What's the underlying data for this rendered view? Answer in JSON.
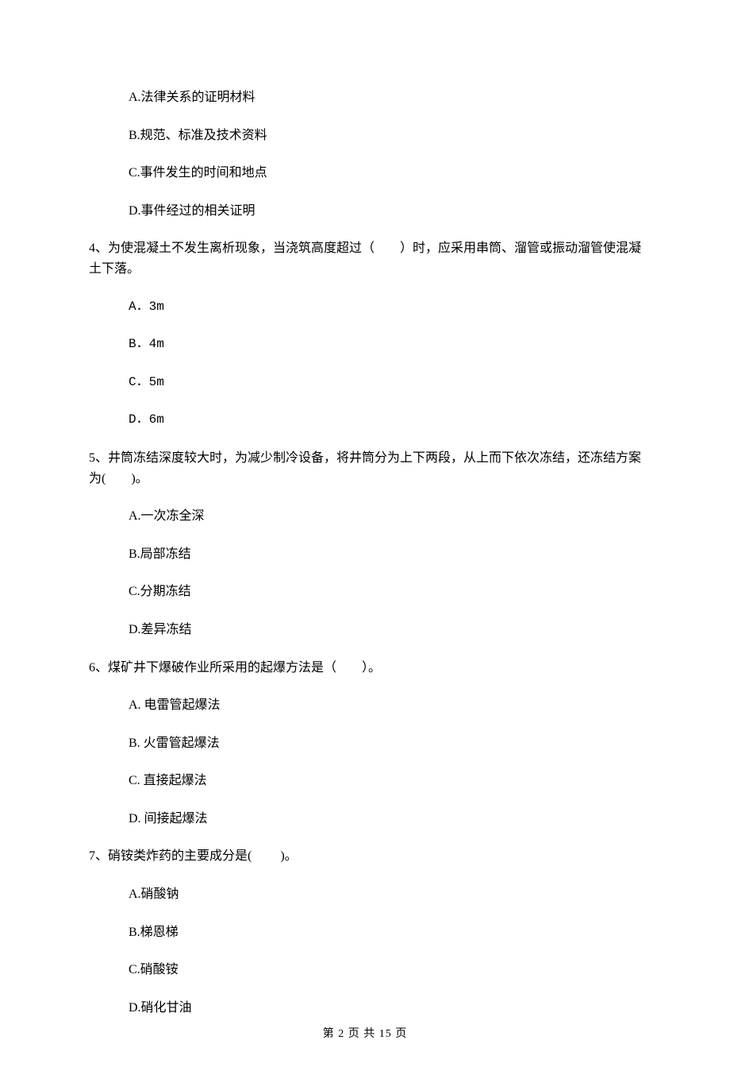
{
  "q3": {
    "options": {
      "A": "A.法律关系的证明材料",
      "B": "B.规范、标准及技术资料",
      "C": "C.事件发生的时间和地点",
      "D": "D.事件经过的相关证明"
    }
  },
  "q4": {
    "stem": "4、为使混凝土不发生离析现象，当浇筑高度超过（　　）时，应采用串筒、溜管或振动溜管使混凝土下落。",
    "options": {
      "A": "A．3m",
      "B": "B．4m",
      "C": "C．5m",
      "D": "D．6m"
    }
  },
  "q5": {
    "stem": "5、井筒冻结深度较大时，为减少制冷设备，将井筒分为上下两段，从上而下依次冻结，还冻结方案为(　　)。",
    "options": {
      "A": "A.一次冻全深",
      "B": "B.局部冻结",
      "C": "C.分期冻结",
      "D": "D.差异冻结"
    }
  },
  "q6": {
    "stem": "6、煤矿井下爆破作业所采用的起爆方法是（　　）。",
    "options": {
      "A": "A. 电雷管起爆法",
      "B": "B. 火雷管起爆法",
      "C": "C. 直接起爆法",
      "D": "D. 间接起爆法"
    }
  },
  "q7": {
    "stem": "7、硝铵类炸药的主要成分是(　　 )。",
    "options": {
      "A": "A.硝酸钠",
      "B": "B.梯恩梯",
      "C": "C.硝酸铵",
      "D": "D.硝化甘油"
    }
  },
  "footer": "第 2 页 共 15 页"
}
